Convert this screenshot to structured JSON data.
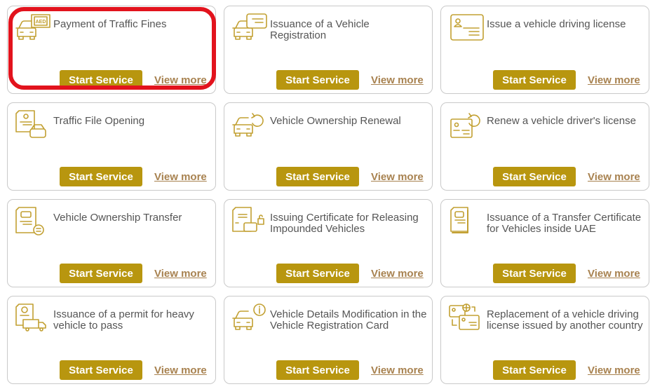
{
  "accent_color": "#b8960f",
  "link_color": "#a88250",
  "highlight_color": "#e2131d",
  "highlighted_card_index": 0,
  "services": [
    {
      "title": "Payment of Traffic Fines",
      "icon": "car-fine-aed-icon",
      "start_label": "Start Service",
      "more_label": "View more"
    },
    {
      "title": "Issuance of a Vehicle Registration",
      "icon": "car-registration-card-icon",
      "start_label": "Start Service",
      "more_label": "View more"
    },
    {
      "title": "Issue a vehicle driving license",
      "icon": "driving-license-card-icon",
      "start_label": "Start Service",
      "more_label": "View more"
    },
    {
      "title": "Traffic File Opening",
      "icon": "traffic-file-document-car-icon",
      "start_label": "Start Service",
      "more_label": "View more"
    },
    {
      "title": "Vehicle Ownership Renewal",
      "icon": "car-renew-icon",
      "start_label": "Start Service",
      "more_label": "View more"
    },
    {
      "title": "Renew a vehicle driver's license",
      "icon": "license-renew-icon",
      "start_label": "Start Service",
      "more_label": "View more"
    },
    {
      "title": "Vehicle Ownership Transfer",
      "icon": "ownership-transfer-document-icon",
      "start_label": "Start Service",
      "more_label": "View more"
    },
    {
      "title": "Issuing Certificate for Releasing Impounded Vehicles",
      "icon": "impounded-vehicle-certificate-icon",
      "start_label": "Start Service",
      "more_label": "View more"
    },
    {
      "title": "Issuance of a Transfer Certificate for Vehicles inside UAE",
      "icon": "transfer-certificate-document-icon",
      "start_label": "Start Service",
      "more_label": "View more"
    },
    {
      "title": "Issuance of a permit for heavy vehicle to pass",
      "icon": "heavy-vehicle-permit-icon",
      "start_label": "Start Service",
      "more_label": "View more"
    },
    {
      "title": "Vehicle Details Modification in the Vehicle Registration Card",
      "icon": "car-info-icon",
      "start_label": "Start Service",
      "more_label": "View more"
    },
    {
      "title": "Replacement of a vehicle driving license issued by another country",
      "icon": "license-replacement-globe-icon",
      "start_label": "Start Service",
      "more_label": "View more"
    }
  ]
}
